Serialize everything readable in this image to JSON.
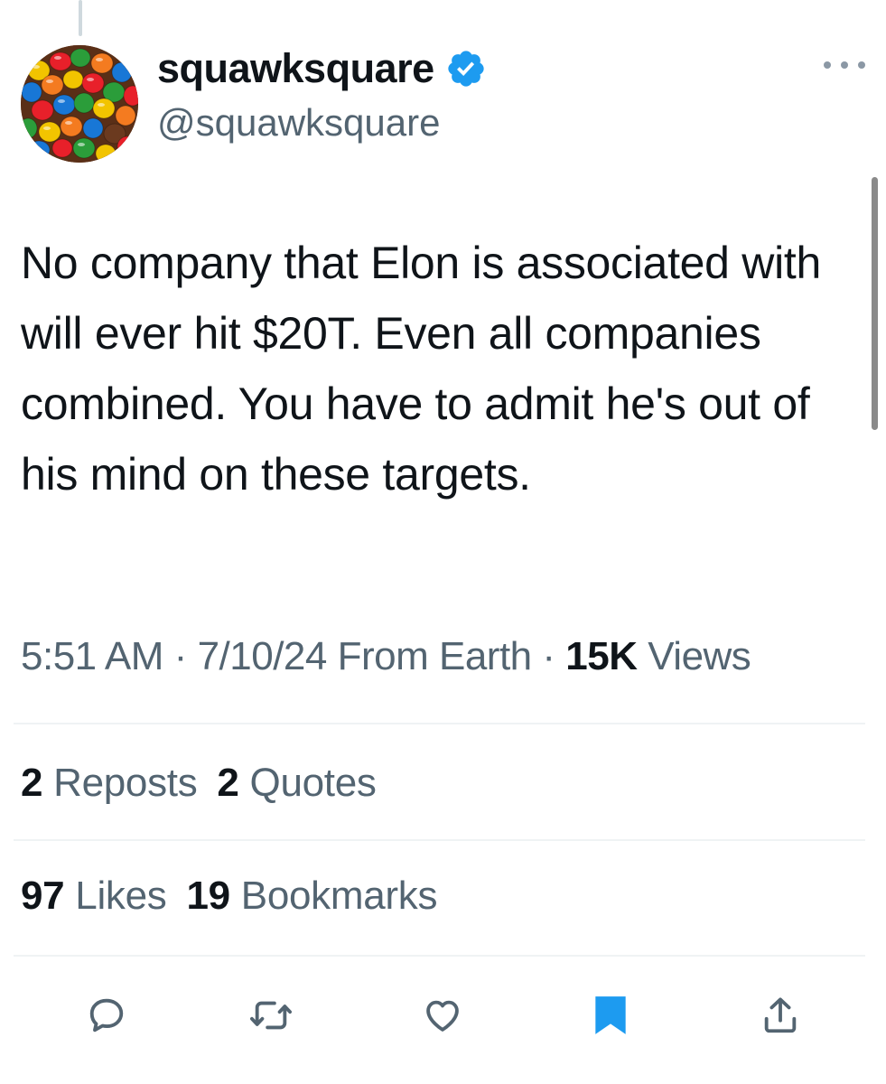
{
  "tweet": {
    "display_name": "squawksquare",
    "handle": "@squawksquare",
    "verified": true,
    "text": "No company that Elon is associated with will ever hit $20T. Even all companies combined. You have to admit he's out of his mind on these targets.",
    "time": "5:51 AM",
    "date": "7/10/24",
    "source": "From Earth",
    "separator": "·",
    "views_count": "15K",
    "views_label": "Views"
  },
  "stats": {
    "reposts_count": "2",
    "reposts_label": "Reposts",
    "quotes_count": "2",
    "quotes_label": "Quotes",
    "likes_count": "97",
    "likes_label": "Likes",
    "bookmarks_count": "19",
    "bookmarks_label": "Bookmarks"
  },
  "actions": {
    "bookmarked": true,
    "icons": [
      "reply-icon",
      "retweet-icon",
      "like-icon",
      "bookmark-icon",
      "share-icon"
    ]
  },
  "colors": {
    "accent": "#1d9bf0",
    "text_primary": "#0f1419",
    "text_secondary": "#536471"
  }
}
